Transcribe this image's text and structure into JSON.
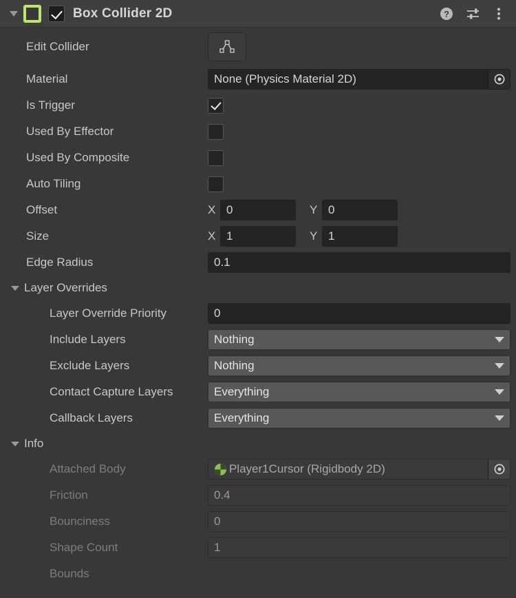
{
  "header": {
    "title": "Box Collider 2D",
    "enabled": true,
    "icon_name": "box-collider-2d-icon",
    "icon_color": "#bde66b",
    "foldout_open": true,
    "actions": [
      {
        "name": "help-icon",
        "label": "?"
      },
      {
        "name": "preset-icon",
        "label": ""
      },
      {
        "name": "more-menu-icon",
        "label": ""
      }
    ]
  },
  "fields": {
    "edit_collider_label": "Edit Collider",
    "edit_collider_icon": "polygon-edit-icon",
    "material_label": "Material",
    "material_value": "None (Physics Material 2D)",
    "is_trigger_label": "Is Trigger",
    "is_trigger_value": true,
    "used_by_effector_label": "Used By Effector",
    "used_by_effector_value": false,
    "used_by_composite_label": "Used By Composite",
    "used_by_composite_value": false,
    "auto_tiling_label": "Auto Tiling",
    "auto_tiling_value": false,
    "offset_label": "Offset",
    "offset_x_axis": "X",
    "offset_x": "0",
    "offset_y_axis": "Y",
    "offset_y": "0",
    "size_label": "Size",
    "size_x_axis": "X",
    "size_x": "1",
    "size_y_axis": "Y",
    "size_y": "1",
    "edge_radius_label": "Edge Radius",
    "edge_radius_value": "0.1"
  },
  "layer_overrides": {
    "section_label": "Layer Overrides",
    "priority_label": "Layer Override Priority",
    "priority_value": "0",
    "include_layers_label": "Include Layers",
    "include_layers_value": "Nothing",
    "exclude_layers_label": "Exclude Layers",
    "exclude_layers_value": "Nothing",
    "contact_capture_label": "Contact Capture Layers",
    "contact_capture_value": "Everything",
    "callback_layers_label": "Callback Layers",
    "callback_layers_value": "Everything"
  },
  "info": {
    "section_label": "Info",
    "attached_body_label": "Attached Body",
    "attached_body_value": "Player1Cursor (Rigidbody 2D)",
    "attached_body_icon": "rigidbody-2d-icon",
    "friction_label": "Friction",
    "friction_value": "0.4",
    "bounciness_label": "Bounciness",
    "bounciness_value": "0",
    "shape_count_label": "Shape Count",
    "shape_count_value": "1",
    "bounds_label": "Bounds"
  },
  "colors": {
    "background": "#383838",
    "header_bg": "#3f3f3f",
    "input_bg": "#242424",
    "dropdown_bg": "#585858",
    "accent_green": "#bde66b",
    "label_text": "#c7c7c7",
    "dim_text": "#7d7d7d"
  }
}
